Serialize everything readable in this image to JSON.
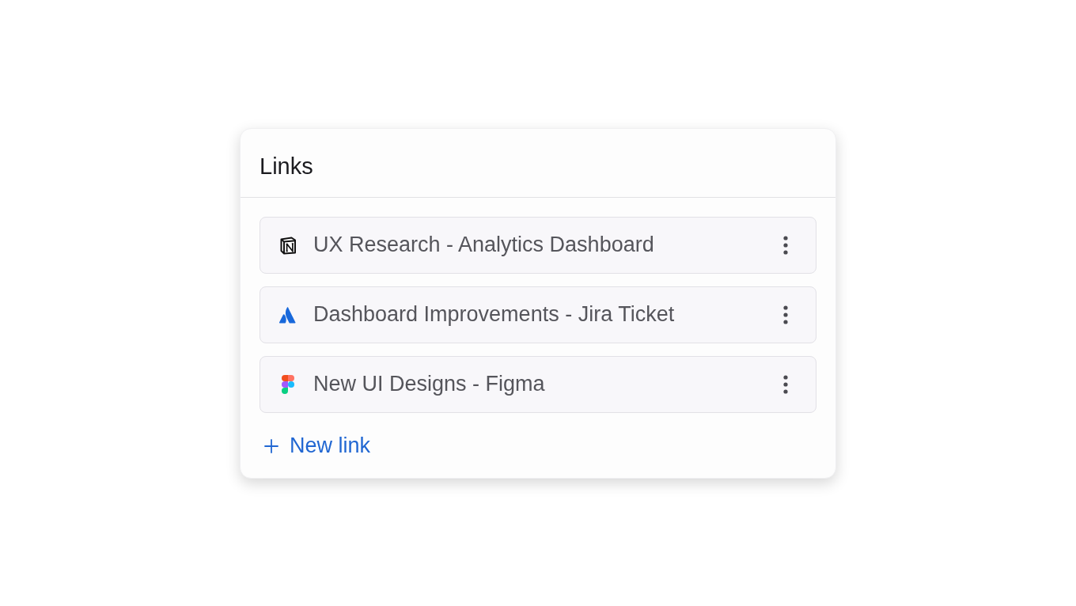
{
  "card": {
    "title": "Links"
  },
  "links": [
    {
      "kind": "doc",
      "title": "UX Research - Analytics Dashboard"
    },
    {
      "kind": "ticket",
      "title": "Dashboard Improvements - Jira Ticket"
    },
    {
      "kind": "design",
      "title": "New UI Designs - Figma"
    }
  ],
  "add_button": {
    "label": "New link"
  }
}
